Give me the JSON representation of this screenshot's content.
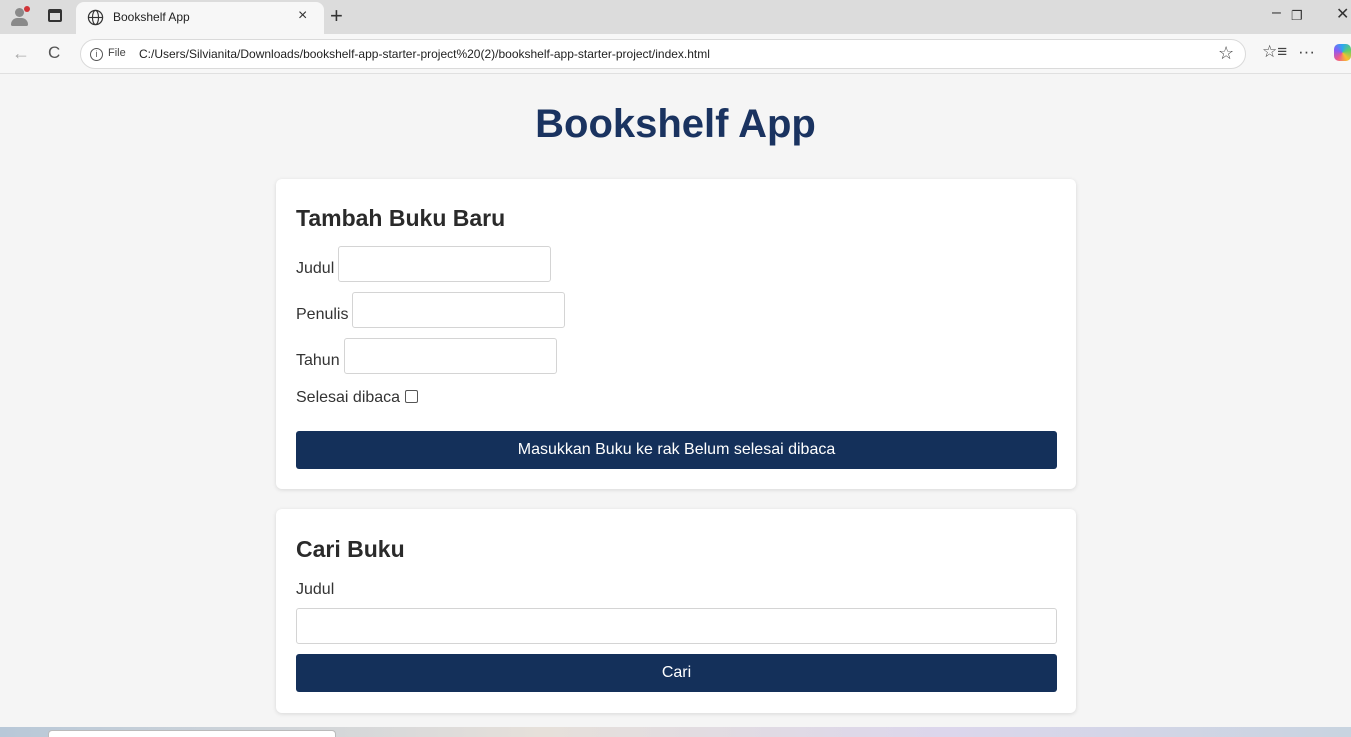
{
  "browser": {
    "tab_title": "Bookshelf App",
    "tab_close": "×",
    "new_tab": "+",
    "minimize": "–",
    "restore": "❐",
    "close": "✕",
    "back": "←",
    "reload": "C",
    "info_glyph": "i",
    "address_scheme": "File",
    "url": "C:/Users/Silvianita/Downloads/bookshelf-app-starter-project%20(2)/bookshelf-app-starter-project/index.html",
    "favorite": "☆",
    "favorites_bar": "☆≡",
    "more": "···",
    "icons": [
      "profile-icon",
      "tab-actions-icon",
      "globe-icon",
      "info-icon",
      "star-icon",
      "favorites-icon",
      "more-icon",
      "copilot-icon"
    ]
  },
  "app": {
    "title": "Bookshelf App"
  },
  "add_book": {
    "heading": "Tambah Buku Baru",
    "judul_label": "Judul",
    "judul_value": "",
    "penulis_label": "Penulis",
    "penulis_value": "",
    "tahun_label": "Tahun",
    "tahun_value": "",
    "selesai_label": "Selesai dibaca",
    "selesai_checked": false,
    "submit_label": "Masukkan Buku ke rak Belum selesai dibaca"
  },
  "search": {
    "heading": "Cari Buku",
    "judul_label": "Judul",
    "judul_value": "",
    "submit_label": "Cari"
  },
  "colors": {
    "title": "#1a3360",
    "button": "#14305a",
    "page_bg": "#f5f5f5"
  }
}
